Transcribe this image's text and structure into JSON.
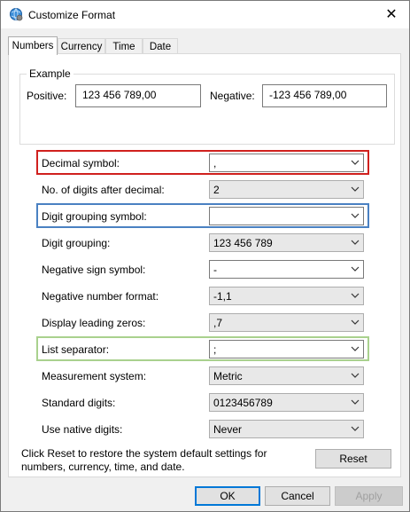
{
  "window": {
    "title": "Customize Format",
    "close_glyph": "✕"
  },
  "tabs": [
    {
      "label": "Numbers",
      "active": true
    },
    {
      "label": "Currency",
      "active": false
    },
    {
      "label": "Time",
      "active": false
    },
    {
      "label": "Date",
      "active": false
    }
  ],
  "example": {
    "legend": "Example",
    "positive_label": "Positive:",
    "positive_value": "123 456 789,00",
    "negative_label": "Negative:",
    "negative_value": "-123 456 789,00"
  },
  "settings": [
    {
      "label": "Decimal symbol:",
      "value": ",",
      "editable": true
    },
    {
      "label": "No. of digits after decimal:",
      "value": "2",
      "editable": false
    },
    {
      "label": "Digit grouping symbol:",
      "value": "",
      "editable": true
    },
    {
      "label": "Digit grouping:",
      "value": "123 456 789",
      "editable": false
    },
    {
      "label": "Negative sign symbol:",
      "value": "-",
      "editable": true
    },
    {
      "label": "Negative number format:",
      "value": "-1,1",
      "editable": false
    },
    {
      "label": "Display leading zeros:",
      "value": ",7",
      "editable": false
    },
    {
      "label": "List separator:",
      "value": ";",
      "editable": true
    },
    {
      "label": "Measurement system:",
      "value": "Metric",
      "editable": false
    },
    {
      "label": "Standard digits:",
      "value": "0123456789",
      "editable": false
    },
    {
      "label": "Use native digits:",
      "value": "Never",
      "editable": false
    }
  ],
  "highlights": {
    "red": "#d0201e",
    "blue": "#4a81c2",
    "green": "#a9d18e"
  },
  "reset_text": "Click Reset to restore the system default settings for numbers, currency, time, and date.",
  "buttons": {
    "reset": "Reset",
    "ok": "OK",
    "cancel": "Cancel",
    "apply": "Apply"
  },
  "icons": {
    "app": "globe-settings-icon",
    "chevron": "chevron-down-icon"
  }
}
